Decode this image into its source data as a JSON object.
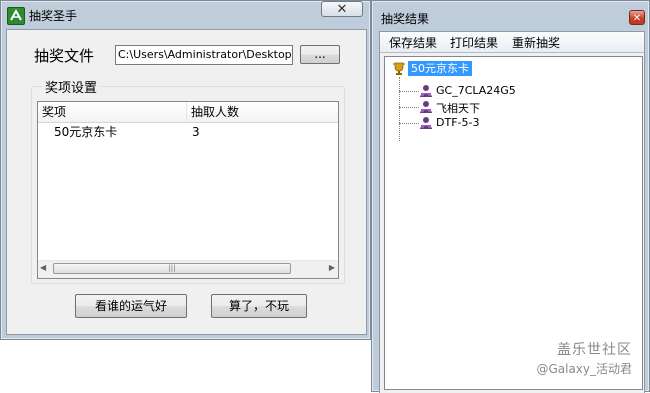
{
  "left_window": {
    "title": "抽奖圣手",
    "close_glyph": "✕",
    "file_label": "抽奖文件",
    "file_path": "C:\\Users\\Administrator\\Desktop\\新",
    "browse_label": "...",
    "prize_group_label": "奖项设置",
    "columns": [
      "奖项",
      "抽取人数"
    ],
    "rows": [
      {
        "prize": "50元京东卡",
        "count": "3"
      }
    ],
    "scroll_left": "◀",
    "scroll_right": "▶",
    "scroll_grip": "|||",
    "draw_button": "看谁的运气好",
    "quit_button": "算了，不玩"
  },
  "right_window": {
    "title": "抽奖结果",
    "close_glyph": "✕",
    "menu": [
      "保存结果",
      "打印结果",
      "重新抽奖"
    ],
    "tree": {
      "root": "50元京东卡",
      "children": [
        "GC_7CLA24G5",
        "飞相天下",
        "DTF-5-3"
      ]
    }
  },
  "watermark": {
    "line1": "盖乐世社区",
    "line2": "@Galaxy_活动君"
  },
  "colors": {
    "titlebar": "#bfcddb",
    "client": "#f0f0f0",
    "selection": "#3399ff",
    "close_red": "#c7452c"
  }
}
